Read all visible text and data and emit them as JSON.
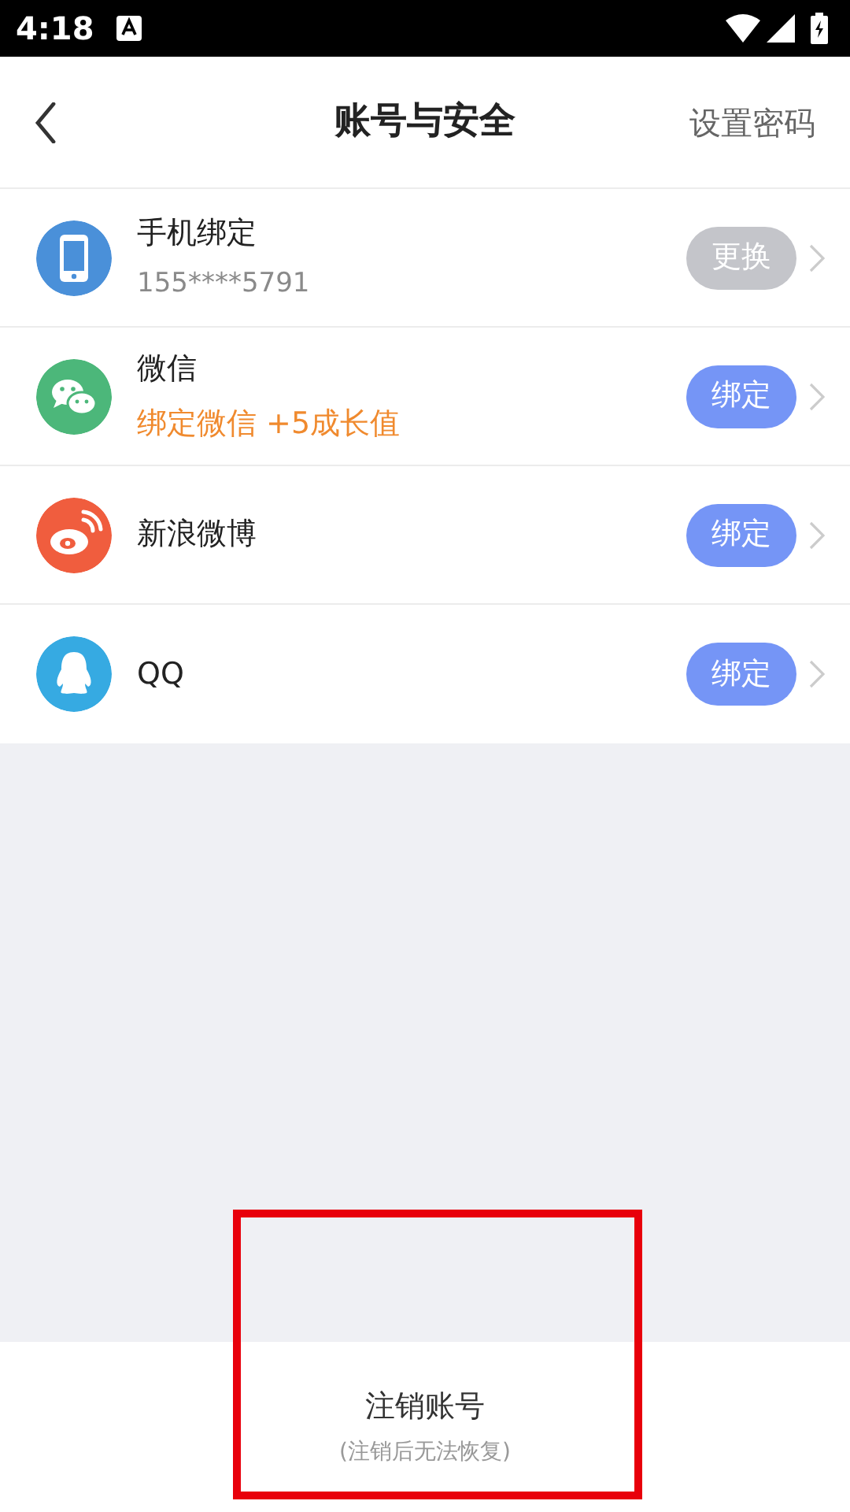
{
  "status_bar": {
    "time": "4:18"
  },
  "header": {
    "title": "账号与安全",
    "action": "设置密码"
  },
  "accounts": [
    {
      "kind": "phone",
      "name": "手机绑定",
      "detail": {
        "kind": "masked",
        "text": "155****5791"
      },
      "button": "更换",
      "bound": true,
      "color": "#4a90d9"
    },
    {
      "kind": "wechat",
      "name": "微信",
      "detail": {
        "kind": "reward",
        "text": "绑定微信 +5成长值"
      },
      "button": "绑定",
      "bound": false,
      "color": "#4cb77a"
    },
    {
      "kind": "weibo",
      "name": "新浪微博",
      "button": "绑定",
      "bound": false,
      "color": "#f05d3e"
    },
    {
      "kind": "qq",
      "name": "QQ",
      "button": "绑定",
      "bound": false,
      "color": "#36aae2"
    }
  ],
  "footer": {
    "title": "注销账号",
    "subtitle": "(注销后无法恢复)",
    "highlighted": true
  }
}
